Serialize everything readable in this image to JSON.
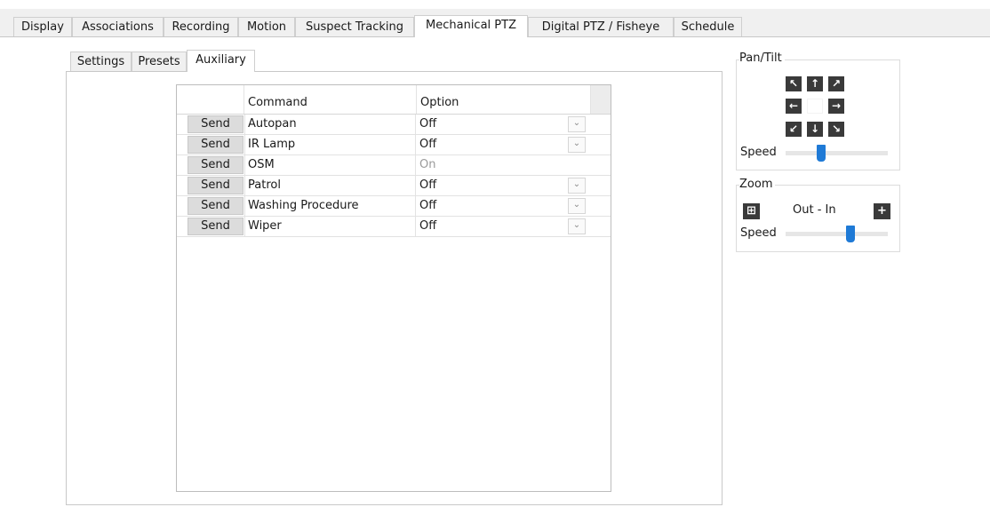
{
  "top_tabs": [
    {
      "label": "Display"
    },
    {
      "label": "Associations"
    },
    {
      "label": "Recording"
    },
    {
      "label": "Motion"
    },
    {
      "label": "Suspect Tracking"
    },
    {
      "label": "Mechanical PTZ",
      "active": true
    },
    {
      "label": "Digital PTZ / Fisheye"
    },
    {
      "label": "Schedule"
    }
  ],
  "sub_tabs": [
    {
      "label": "Settings"
    },
    {
      "label": "Presets"
    },
    {
      "label": "Auxiliary",
      "active": true
    }
  ],
  "grid": {
    "headers": {
      "command": "Command",
      "option": "Option"
    },
    "send_label": "Send",
    "rows": [
      {
        "command": "Autopan",
        "option": "Off",
        "has_dropdown": true
      },
      {
        "command": "IR Lamp",
        "option": "Off",
        "has_dropdown": true
      },
      {
        "command": "OSM",
        "option": "On",
        "has_dropdown": false,
        "disabled": true
      },
      {
        "command": "Patrol",
        "option": "Off",
        "has_dropdown": true
      },
      {
        "command": "Washing Procedure",
        "option": "Off",
        "has_dropdown": true
      },
      {
        "command": "Wiper",
        "option": "Off",
        "has_dropdown": true
      }
    ]
  },
  "pan_tilt": {
    "title": "Pan/Tilt",
    "speed_label": "Speed",
    "speed_value": 0.33,
    "icons": [
      "arrow-up-left-icon",
      "arrow-up-icon",
      "arrow-up-right-icon",
      "arrow-left-icon",
      "arrow-right-icon",
      "arrow-down-left-icon",
      "arrow-down-icon",
      "arrow-down-right-icon"
    ]
  },
  "zoom": {
    "title": "Zoom",
    "label": "Out - In",
    "speed_label": "Speed",
    "speed_value": 0.65,
    "icons": [
      "zoom-out-icon",
      "zoom-in-icon"
    ]
  },
  "colors": {
    "accent": "#1f7ad6",
    "button_dark": "#3a3a3a"
  }
}
